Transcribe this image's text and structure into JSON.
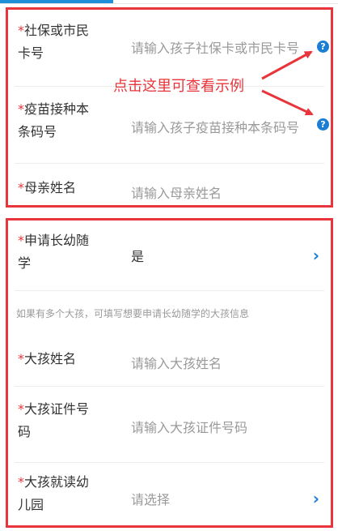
{
  "form": {
    "ssn": {
      "star": "*",
      "label_line1": "社保或市民",
      "label_line2": "卡号",
      "placeholder": "请输入孩子社保卡或市民卡号",
      "help": "?"
    },
    "vaccine": {
      "star": "*",
      "label_line1": "疫苗接种本",
      "label_line2": "条码号",
      "placeholder": "请输入孩子疫苗接种本条码号",
      "help": "?"
    },
    "mother": {
      "star": "*",
      "label": "母亲姓名",
      "placeholder": "请输入母亲姓名"
    },
    "sibling_apply": {
      "star": "*",
      "label_line1": "申请长幼随",
      "label_line2": "学",
      "value": "是"
    },
    "hint": "如果有多个大孩，可填写想要申请长幼随学的大孩信息",
    "elder_name": {
      "star": "*",
      "label": "大孩姓名",
      "placeholder": "请输入大孩姓名"
    },
    "elder_id": {
      "star": "*",
      "label_line1": "大孩证件号",
      "label_line2": "码",
      "placeholder": "请输入大孩证件号码"
    },
    "elder_kinder": {
      "star": "*",
      "label_line1": "大孩就读幼",
      "label_line2": "儿园",
      "value": "请选择"
    }
  },
  "annotation": {
    "text": "点击这里可查看示例"
  },
  "colors": {
    "accent": "#1a7fd4",
    "annotation": "#e8353b",
    "placeholder": "#9a9a9a"
  }
}
